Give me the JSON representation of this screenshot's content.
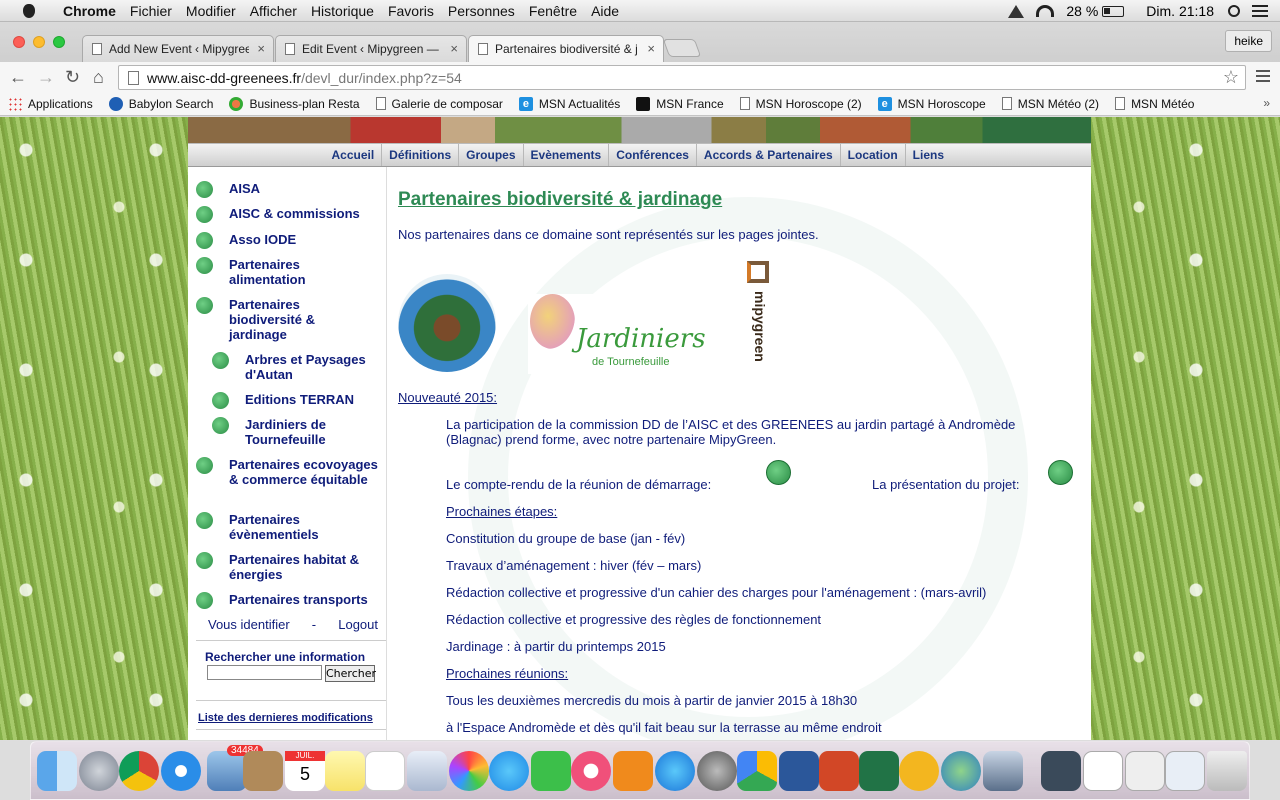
{
  "menubar": {
    "app_name": "Chrome",
    "items": [
      "Fichier",
      "Modifier",
      "Afficher",
      "Historique",
      "Favoris",
      "Personnes",
      "Fenêtre",
      "Aide"
    ],
    "battery": "28 %",
    "clock": "Dim. 21:18"
  },
  "tabs": [
    {
      "title": "Add New Event ‹ Mipygreen"
    },
    {
      "title": "Edit Event ‹ Mipygreen — W"
    },
    {
      "title": "Partenaires biodiversité & j"
    }
  ],
  "profile_name": "heike",
  "address": {
    "domain": "www.aisc-dd-greenees.fr",
    "path": "/devl_dur/index.php?z=54"
  },
  "bookmarks": [
    {
      "label": "Applications",
      "icon": "apps"
    },
    {
      "label": "Babylon Search",
      "icon": "babylon"
    },
    {
      "label": "Business-plan Resta",
      "icon": "bp"
    },
    {
      "label": "Galerie de composar",
      "icon": "page"
    },
    {
      "label": "MSN Actualités",
      "icon": "msn"
    },
    {
      "label": "MSN France",
      "icon": "msnfr"
    },
    {
      "label": "MSN Horoscope (2)",
      "icon": "page"
    },
    {
      "label": "MSN Horoscope",
      "icon": "msn"
    },
    {
      "label": "MSN Météo (2)",
      "icon": "page"
    },
    {
      "label": "MSN Météo",
      "icon": "page"
    }
  ],
  "site": {
    "nav": [
      "Accueil",
      "Définitions",
      "Groupes",
      "Evènements",
      "Conférences",
      "Accords & Partenaires",
      "Location",
      "Liens"
    ],
    "sidebar": [
      {
        "label": "AISA",
        "indent": false
      },
      {
        "label": "AISC & commissions",
        "indent": false
      },
      {
        "label": "Asso IODE",
        "indent": false
      },
      {
        "label": "Partenaires alimentation",
        "indent": false
      },
      {
        "label": "Partenaires biodiversité & jardinage",
        "indent": false
      },
      {
        "label": "Arbres et Paysages d'Autan",
        "indent": true
      },
      {
        "label": "Editions TERRAN",
        "indent": true
      },
      {
        "label": "Jardiniers de Tournefeuille",
        "indent": true
      },
      {
        "label": "Partenaires ecovoyages & commerce équitable",
        "indent": false
      },
      {
        "label": "Partenaires évènementiels",
        "indent": false
      },
      {
        "label": "Partenaires habitat & énergies",
        "indent": false
      },
      {
        "label": "Partenaires transports",
        "indent": false
      }
    ],
    "login": "Vous identifier",
    "login_sep": "-",
    "logout": "Logout",
    "search_label": "Rechercher une information",
    "search_button": "Chercher",
    "last_mods": "Liste des dernieres modifications",
    "title": "Partenaires biodiversité & jardinage",
    "intro": "Nos partenaires dans ce domaine sont représentés sur les pages jointes.",
    "logos": {
      "jardiniers": "Jardiniers",
      "jardiniers_sub": "de Tournefeuille",
      "mipy": "mipygreen"
    },
    "news_title": "Nouveauté 2015:",
    "news_p1_l1": "La participation de la commission DD de l’AISC et des GREENEES au jardin partagé à Andromède",
    "news_p1_l2": "(Blagnac) prend forme, avec notre partenaire MipyGreen.",
    "cr_label": "Le compte-rendu de la réunion de démarrage:",
    "pres_label": "La présentation du projet:",
    "steps_title": "Prochaines étapes:",
    "steps": [
      "Constitution du groupe de base (jan - fév)",
      "Travaux d’aménagement : hiver (fév – mars)",
      "Rédaction collective et progressive d'un cahier des charges pour l'aménagement : (mars-avril)",
      "Rédaction collective et progressive des règles de fonctionnement",
      "Jardinage : à partir du printemps 2015"
    ],
    "meetings_title": "Prochaines réunions:",
    "meeting_l1": "Tous les deuxièmes mercredis du mois à partir de janvier 2015 à 18h30",
    "meeting_l2": "à l'Espace Andromède et dès qu'il fait beau sur la terrasse au même endroit"
  },
  "dock": {
    "mail_badge": "34484",
    "calendar_month": "JUIL.",
    "calendar_day": "5",
    "apps": [
      "finder",
      "launchpad",
      "chrome",
      "safari",
      "mail",
      "contacts",
      "calendar",
      "notes",
      "reminders",
      "preview",
      "photos",
      "messages",
      "facetime",
      "itunes",
      "ibooks",
      "app-store",
      "system-preferences",
      "google-drive",
      "word",
      "powerpoint",
      "excel",
      "outlook",
      "network",
      "image-capture",
      "screen",
      "quicktime",
      "finder-window",
      "downloads",
      "trash"
    ]
  }
}
